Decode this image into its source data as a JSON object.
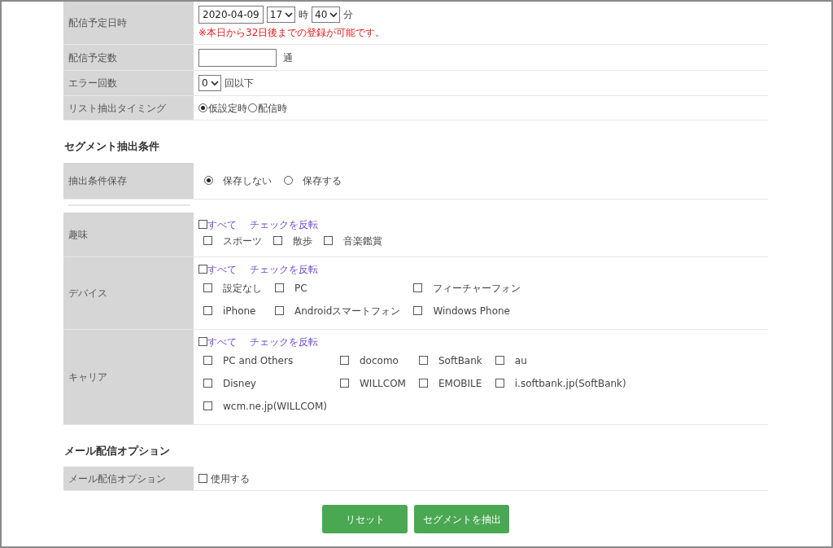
{
  "sections": [
    {
      "rows": [
        {
          "kind": "datetime",
          "label": "配信予定日時",
          "date": "2020-04-09",
          "hour": "17",
          "hour_unit": "時",
          "minute": "40",
          "minute_unit": "分",
          "note": "※本日から32日後までの登録が可能です。"
        },
        {
          "kind": "number",
          "label": "配信予定数",
          "unit": "通"
        },
        {
          "kind": "select",
          "label": "エラー回数",
          "value": "0",
          "unit": "回以下"
        },
        {
          "kind": "radio_compact",
          "label": "リスト抽出タイミング",
          "options": [
            {
              "label": "仮設定時",
              "selected": true
            },
            {
              "label": "配信時",
              "selected": false
            }
          ]
        }
      ]
    },
    {
      "heading": "セグメント抽出条件",
      "rows": [
        {
          "kind": "radio",
          "label": "抽出条件保存",
          "options": [
            {
              "label": "保存しない",
              "selected": true
            },
            {
              "label": "保存する",
              "selected": false
            }
          ]
        },
        {
          "kind": "divider"
        },
        {
          "kind": "checklist",
          "label": "趣味",
          "select_all": {
            "label": "すべて",
            "checked": false
          },
          "invert": "チェックを反転",
          "option_rows": [
            [
              {
                "label": "スポーツ",
                "checked": false
              },
              {
                "label": "散歩",
                "checked": false
              },
              {
                "label": "音楽鑑賞",
                "checked": false
              }
            ]
          ]
        },
        {
          "kind": "checklist",
          "label": "デバイス",
          "select_all": {
            "label": "すべて",
            "checked": false
          },
          "invert": "チェックを反転",
          "option_rows": [
            [
              {
                "label": "設定なし",
                "checked": false
              },
              {
                "label": "PC",
                "checked": false
              },
              {
                "label": "フィーチャーフォン",
                "checked": false
              }
            ],
            [
              {
                "label": "iPhone",
                "checked": false
              },
              {
                "label": "Androidスマートフォン",
                "checked": false
              },
              {
                "label": "Windows Phone",
                "checked": false
              }
            ]
          ]
        },
        {
          "kind": "checklist",
          "label": "キャリア",
          "select_all": {
            "label": "すべて",
            "checked": false
          },
          "invert": "チェックを反転",
          "option_rows": [
            [
              {
                "label": "PC and Others",
                "checked": false
              },
              {
                "label": "docomo",
                "checked": false
              },
              {
                "label": "SoftBank",
                "checked": false
              },
              {
                "label": "au",
                "checked": false
              }
            ],
            [
              {
                "label": "Disney",
                "checked": false
              },
              {
                "label": "WILLCOM",
                "checked": false
              },
              {
                "label": "EMOBILE",
                "checked": false
              },
              {
                "label": "i.softbank.jp(SoftBank)",
                "checked": false
              }
            ],
            [
              {
                "label": "wcm.ne.jp(WILLCOM)",
                "checked": false
              }
            ]
          ]
        }
      ]
    },
    {
      "heading": "メール配信オプション",
      "rows": [
        {
          "kind": "checkbox",
          "label": "メール配信オプション",
          "option": {
            "label": "使用する",
            "checked": false
          }
        }
      ]
    }
  ],
  "buttons": [
    "リセット",
    "セグメントを抽出"
  ]
}
